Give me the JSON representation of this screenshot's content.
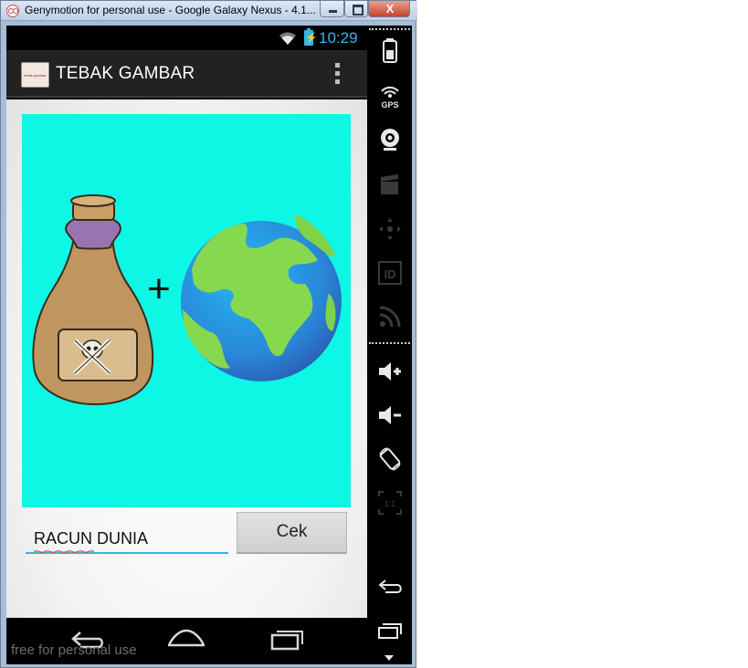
{
  "window": {
    "title": "Genymotion for personal use - Google Galaxy Nexus - 4.1....",
    "close_label": "X"
  },
  "statusbar": {
    "clock": "10:29",
    "battery_icon": "battery-charging-icon",
    "wifi_icon": "wifi-icon"
  },
  "app": {
    "title": "TEBAK GAMBAR",
    "icon_text": "tebak gambar"
  },
  "puzzle": {
    "plus_symbol": "+",
    "image_left": "poison-bottle",
    "image_right": "earth-globe",
    "background_color": "#0df7e4"
  },
  "answer": {
    "value": "RACUN DUNIA",
    "accent_color": "#33b5e5"
  },
  "cek_button": {
    "label": "Cek"
  },
  "watermark": "free for personal use",
  "sidebar": {
    "tools": [
      "battery-icon",
      "gps-icon",
      "webcam-icon",
      "video-capture-icon",
      "dpad-icon",
      "id-icon",
      "rss-icon",
      "volume-up-icon",
      "volume-down-icon",
      "rotate-icon",
      "scale-icon",
      "back-icon",
      "recent-apps-icon",
      "scroll-down-icon"
    ],
    "gps_label": "GPS",
    "id_label": "ID",
    "scale_label": "1:1"
  }
}
